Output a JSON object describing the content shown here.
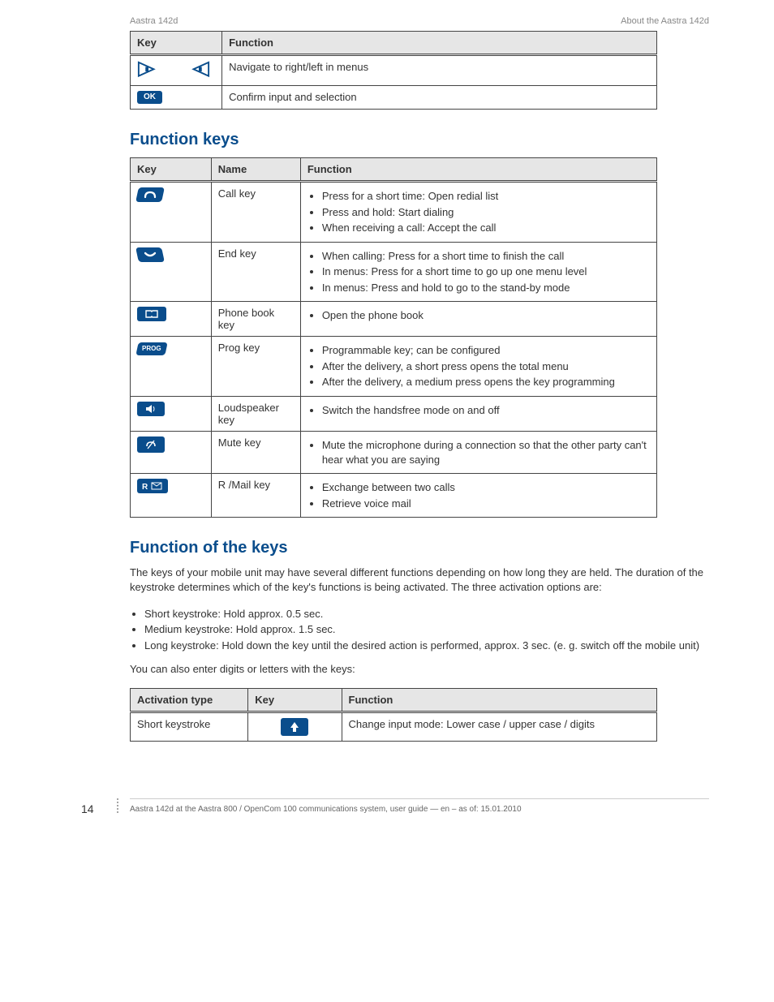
{
  "page_header": {
    "left": "Aastra 142d",
    "right": "About the Aastra 142d"
  },
  "table1": {
    "headers": [
      "Key",
      "Function"
    ],
    "rows": [
      {
        "key_icon": "nav-arrows",
        "func": "Navigate to right/left in menus"
      },
      {
        "key_icon": "ok",
        "key_text": "OK",
        "func": "Confirm input and selection"
      }
    ]
  },
  "section_fk": {
    "title": "Function keys",
    "headers": [
      "Key",
      "Name",
      "Function"
    ],
    "rows": [
      {
        "icon": "call",
        "name": "Call key",
        "items": [
          "Press for a short time: Open redial list",
          "Press and hold: Start dialing",
          "When receiving a call: Accept the call"
        ]
      },
      {
        "icon": "end",
        "name": "End key",
        "items": [
          "When calling: Press for a short time to finish the call",
          "In menus: Press for a short time to go up one menu level",
          "In menus: Press and hold to go to the stand-by mode"
        ]
      },
      {
        "icon": "book",
        "name": "Phone book key",
        "items": [
          "Open the phone book"
        ]
      },
      {
        "icon": "prog",
        "name": "Prog key",
        "items": [
          "Programmable key; can be configured",
          "After the delivery, a short press opens the total menu",
          "After the delivery, a medium press opens the key programming"
        ]
      },
      {
        "icon": "speaker",
        "name": "Loudspeaker key",
        "items": [
          "Switch the handsfree mode on and off"
        ]
      },
      {
        "icon": "mute",
        "name": "Mute key",
        "items": [
          "Mute the microphone during a connection so that the other party can't hear what you are saying"
        ]
      },
      {
        "icon": "rmail",
        "name": "R /Mail key",
        "items": [
          "Exchange between two calls",
          "Retrieve voice mail"
        ]
      }
    ]
  },
  "section_ctrl": {
    "title": "Function of the keys",
    "intro": "The keys of your mobile unit may have several different functions depending on how long they are held. The duration of the keystroke determines which of the key's functions is being activated. The three activation options are:",
    "options": [
      "Short keystroke: Hold approx. 0.5 sec.",
      "Medium keystroke: Hold approx. 1.5 sec.",
      "Long keystroke: Hold down the key until the desired action is performed, approx. 3 sec. (e. g. switch off the mobile unit)"
    ],
    "note": "You can also enter digits or letters with the keys:",
    "headers": [
      "Activation type",
      "Key",
      "Function"
    ],
    "row": {
      "action": "Short keystroke",
      "key_icon": "shift",
      "func": "Change input mode: Lower case / upper case / digits"
    }
  },
  "footer": {
    "page": "14",
    "text": "Aastra 142d at the Aastra 800 / OpenCom 100 communications system, user guide — en – as of: 15.01.2010"
  }
}
